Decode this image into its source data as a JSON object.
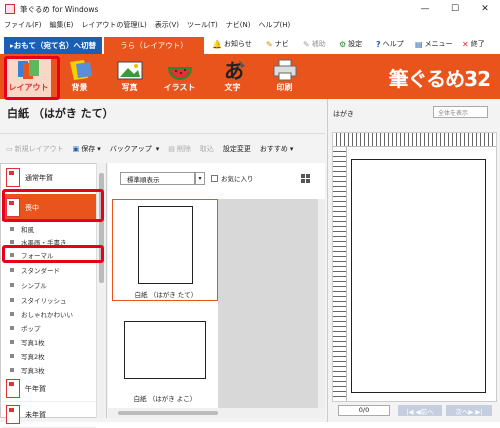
{
  "window": {
    "title": "筆ぐるめ for Windows",
    "minimize": "—",
    "maximize": "☐",
    "close": "✕"
  },
  "menu": [
    "ファイル(F)",
    "編集(E)",
    "レイアウトの管理(L)",
    "表示(V)",
    "ツール(T)",
    "ナビ(N)",
    "ヘルプ(H)"
  ],
  "tabs": {
    "front": "▸おもて（宛て名）へ切替",
    "back": "うら（レイアウト）"
  },
  "top_tools": [
    {
      "label": "お知らせ",
      "icon": "bell-icon",
      "glyph": "🔔"
    },
    {
      "label": "ナビ",
      "icon": "pen-icon",
      "glyph": "✎"
    },
    {
      "label": "補助",
      "icon": "helper-icon",
      "glyph": "✎"
    },
    {
      "label": "設定",
      "icon": "gear-icon",
      "glyph": "⚙"
    },
    {
      "label": "ヘルプ",
      "icon": "help-icon",
      "glyph": "?"
    },
    {
      "label": "メニュー",
      "icon": "menu-icon",
      "glyph": "▤"
    },
    {
      "label": "終了",
      "icon": "close-icon",
      "glyph": "✕"
    }
  ],
  "ribbon": {
    "buttons": [
      "レイアウト",
      "背景",
      "写真",
      "イラスト",
      "文字",
      "印刷"
    ],
    "brand": "筆ぐるめ32"
  },
  "layout_title": "白紙 （はがき たて）",
  "toolbar": {
    "new_layout": "新規レイアウト",
    "save": "保存",
    "backup": "バックアップ",
    "delete": "削除",
    "import": "取込",
    "change_settings": "設定変更",
    "recommended": "おすすめ"
  },
  "sidebar": {
    "categories": [
      "通常年賀",
      "喪中",
      "午年賀",
      "未年賀"
    ],
    "subitems": [
      "和風",
      "水墨画・手書き",
      "フォーマル",
      "スタンダード",
      "シンプル",
      "スタイリッシュ",
      "おしゃれかわいい",
      "ポップ",
      "写真1枚",
      "写真2枚",
      "写真3枚"
    ]
  },
  "content": {
    "sort_select": "標準順表示",
    "favorites": "お気に入り",
    "cards": [
      "白紙 （はがき たて）",
      "白紙 （はがき よこ）"
    ]
  },
  "preview": {
    "label": "はがき",
    "view_select": "全体を表示",
    "page_count": "0/0",
    "prev": "|◀ ◀前へ",
    "next": "次へ▶ ▶|"
  },
  "colors": {
    "accent": "#e8541c",
    "tab_blue": "#1b5fb4",
    "highlight": "#e6001a"
  }
}
